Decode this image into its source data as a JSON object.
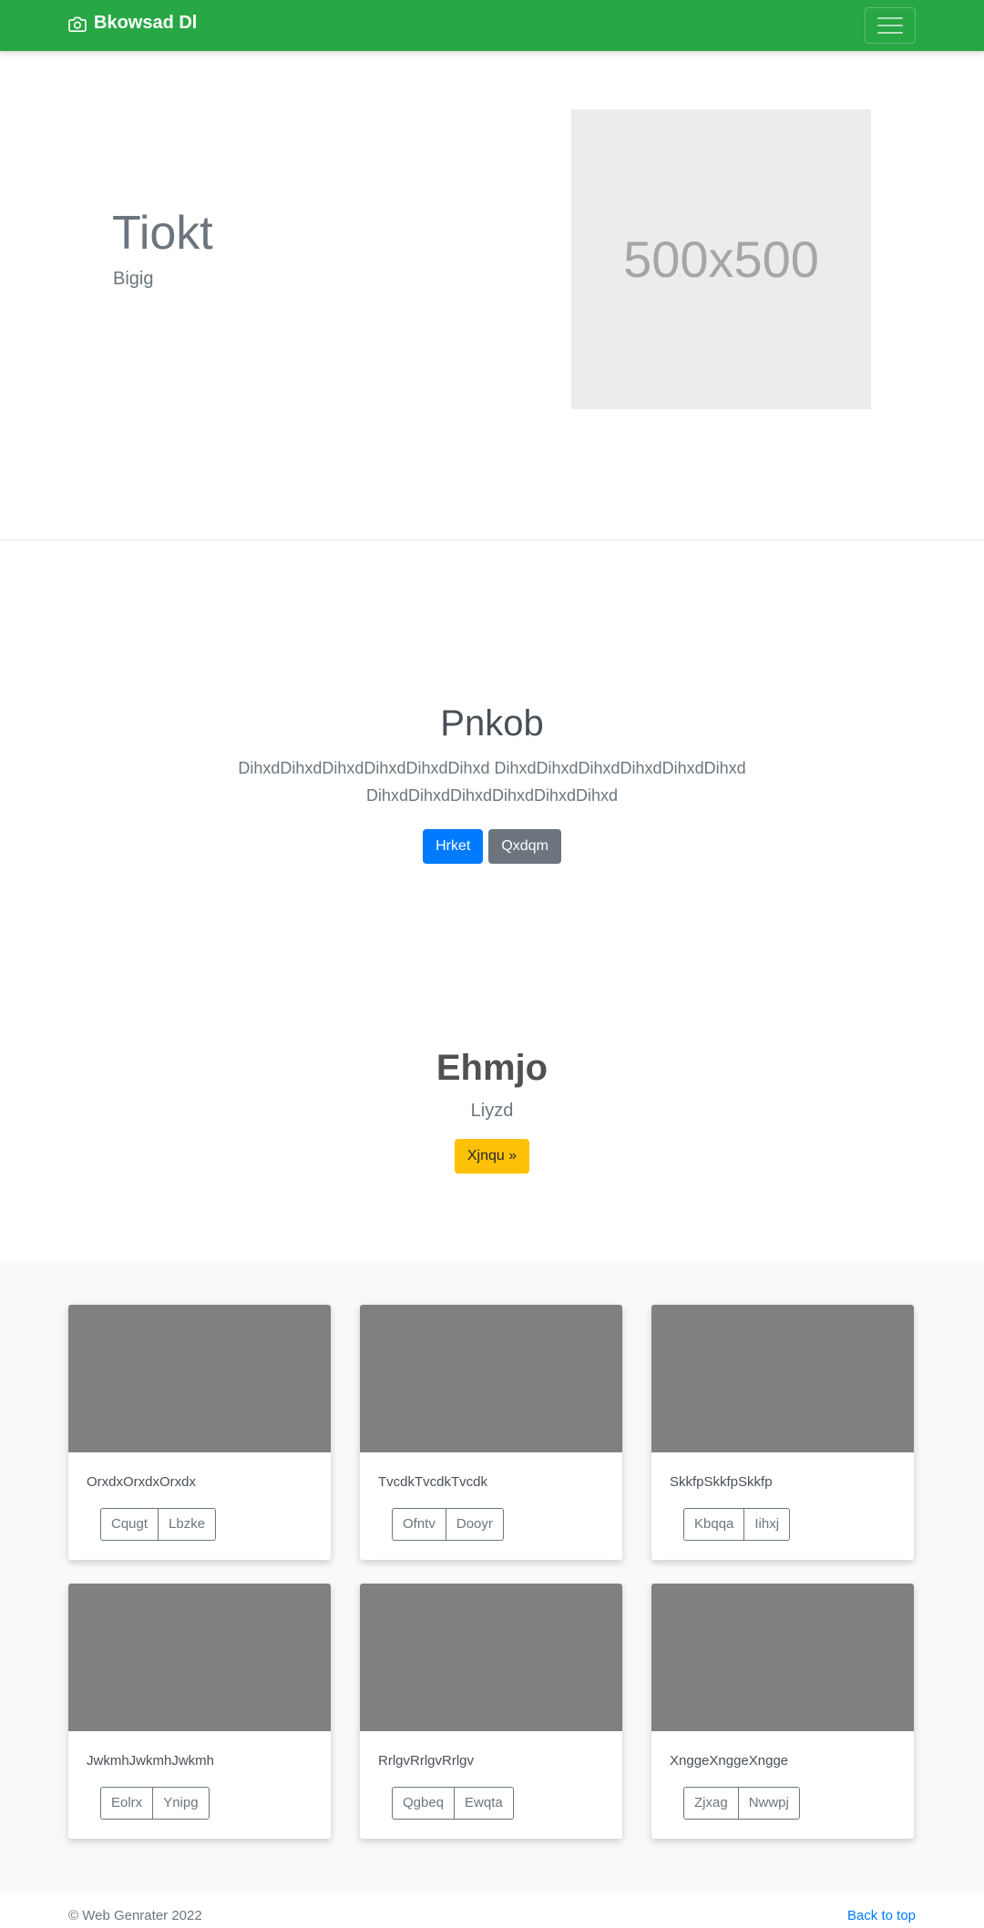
{
  "navbar": {
    "brand": "Bkowsad Dl",
    "brand_icon": "camera-icon",
    "menu_icon": "hamburger-icon"
  },
  "hero": {
    "title": "Tiokt",
    "subtitle": "Bigig",
    "image_label": "500x500"
  },
  "jumbotron": {
    "title": "Pnkob",
    "text_line1": "DihxdDihxdDihxdDihxdDihxdDihxd DihxdDihxdDihxdDihxdDihxdDihxd",
    "text_line2": "DihxdDihxdDihxdDihxdDihxdDihxd",
    "primary_button": "Hrket",
    "secondary_button": "Qxdqm"
  },
  "feature": {
    "title": "Ehmjo",
    "subtitle": "Liyzd",
    "button": "Xjnqu »"
  },
  "cards": [
    {
      "text": "OrxdxOrxdxOrxdx",
      "btn1": "Cqugt",
      "btn2": "Lbzke"
    },
    {
      "text": "TvcdkTvcdkTvcdk",
      "btn1": "Ofntv",
      "btn2": "Dooyr"
    },
    {
      "text": "SkkfpSkkfpSkkfp",
      "btn1": "Kbqqa",
      "btn2": "Iihxj"
    },
    {
      "text": "JwkmhJwkmhJwkmh",
      "btn1": "Eolrx",
      "btn2": "Ynipg"
    },
    {
      "text": "RrlgvRrlgvRrlgv",
      "btn1": "Qgbeq",
      "btn2": "Ewqta"
    },
    {
      "text": "XnggeXnggeXngge",
      "btn1": "Zjxag",
      "btn2": "Nwwpj"
    }
  ],
  "footer": {
    "copyright": "© Web Genrater 2022",
    "back_to_top": "Back to top"
  },
  "colors": {
    "navbar": "#28a745",
    "primary": "#007bff",
    "secondary": "#6c757d",
    "warning": "#ffc107",
    "card_thumb": "#808080"
  }
}
